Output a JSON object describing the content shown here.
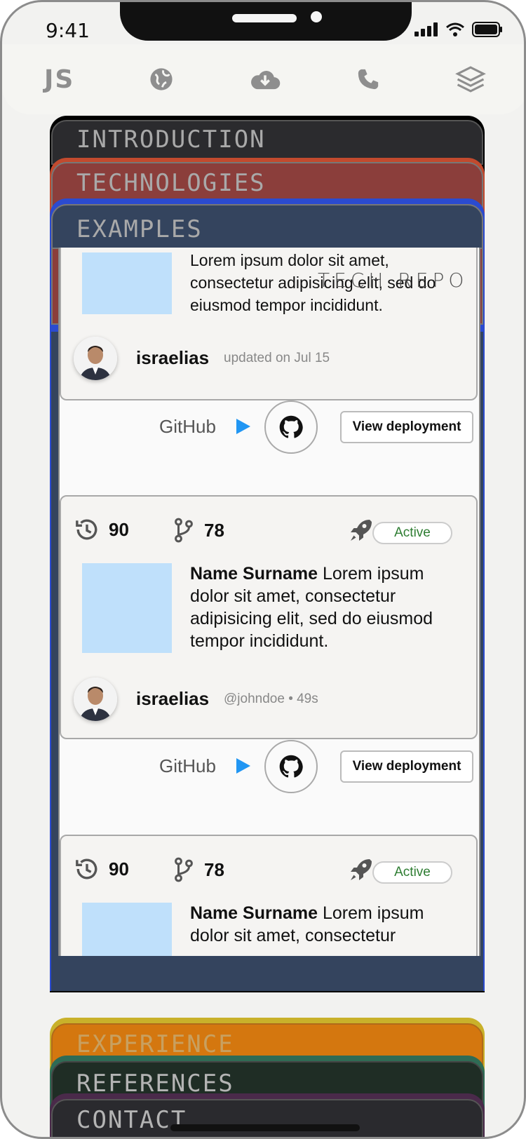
{
  "status_bar": {
    "time": "9:41"
  },
  "topnav": {
    "logo": "JS",
    "icons": [
      "globe-icon",
      "cloud-download-icon",
      "phone-icon",
      "layers-icon"
    ]
  },
  "sections": {
    "introduction": "INTRODUCTION",
    "technologies": "TECHNOLOGIES",
    "examples": "EXAMPLES",
    "experience": "EXPERIENCE",
    "references": "REFERENCES",
    "contact": "CONTACT"
  },
  "overlay_heading": "TECH REPO",
  "cards": [
    {
      "description": "Lorem ipsum dolor sit amet, consectetur adipisicing elit, sed do eiusmod tempor incididunt.",
      "user": "israelias",
      "meta": "updated on Jul 15",
      "github_label": "GitHub",
      "deploy_label": "View deployment"
    },
    {
      "commits": "90",
      "branches": "78",
      "status": "Active",
      "author": "Name Surname",
      "description": "Lorem ipsum dolor sit amet, consectetur adipisicing elit, sed do eiusmod tempor incididunt.",
      "user": "israelias",
      "meta": "@johndoe • 49s",
      "github_label": "GitHub",
      "deploy_label": "View deployment"
    },
    {
      "commits": "90",
      "branches": "78",
      "status": "Active",
      "author": "Name Surname",
      "description": "Lorem ipsum dolor sit amet, consectetur"
    }
  ],
  "colors": {
    "introduction": "#2b2b2e",
    "technologies": "#8b3e3b",
    "examples": "#34445e",
    "experience": "#d4770f",
    "references": "#1f2d25",
    "contact": "#2a2a2e",
    "accent_blue": "#2196f3",
    "active_green": "#2e7d32"
  }
}
